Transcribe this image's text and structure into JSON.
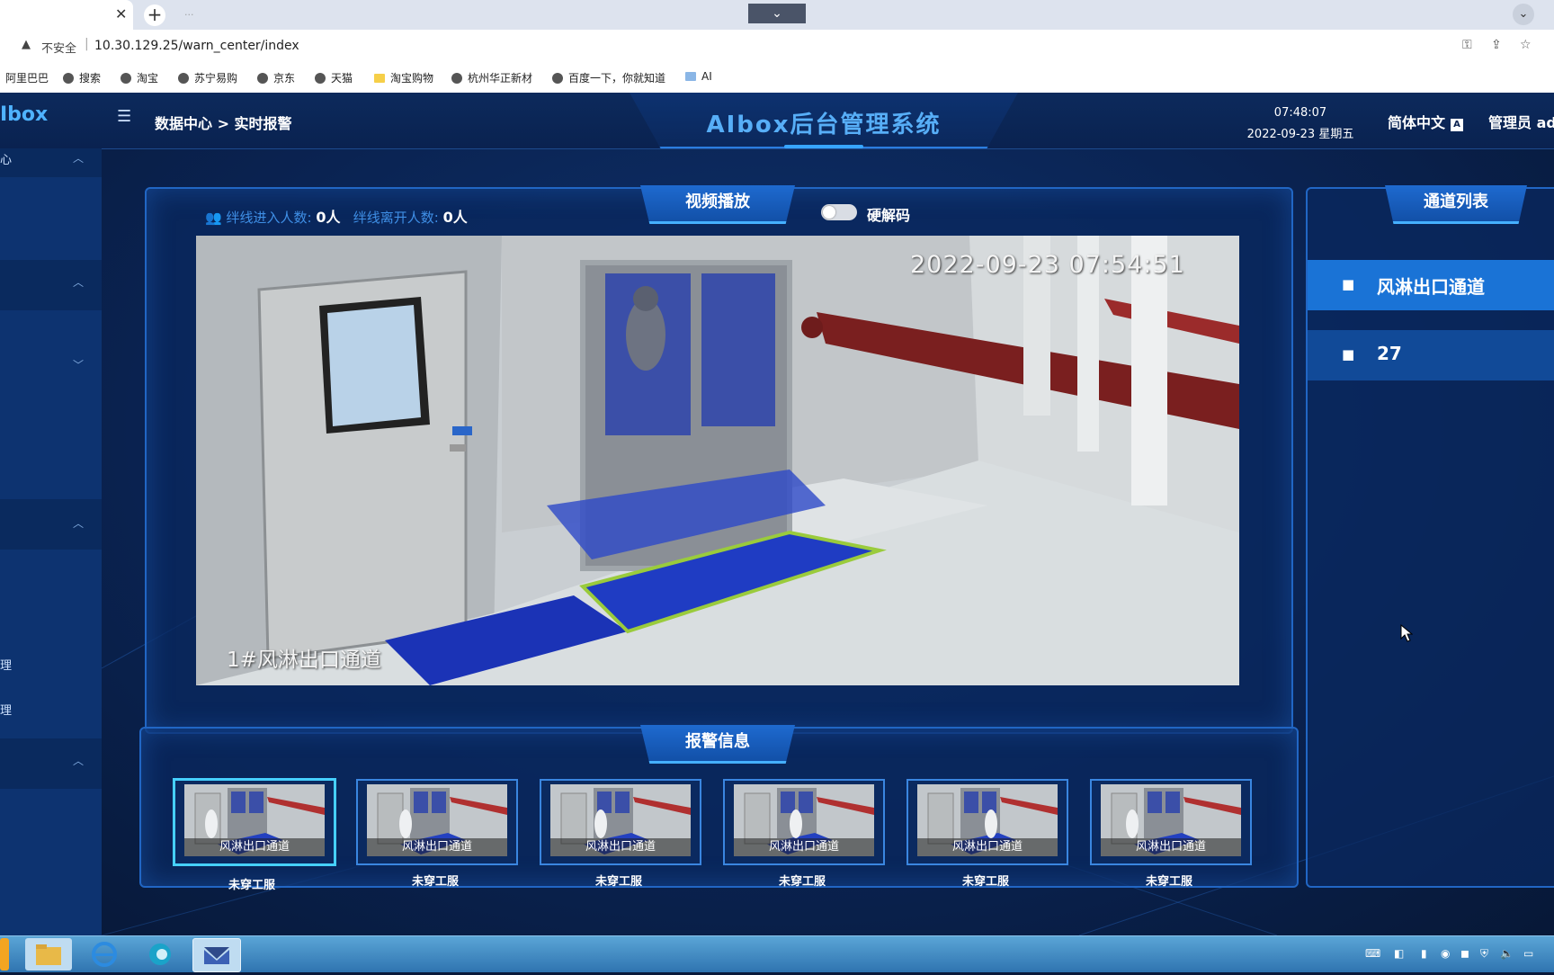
{
  "browser": {
    "tab_close": "✕",
    "new_tab": "+",
    "tab2_title": "···",
    "dropdown": "⌄",
    "tab_search": "⌄",
    "security_icon": "warning-icon",
    "insecure_label": "不安全",
    "url": "10.30.129.25/warn_center/index",
    "bookmarks": [
      "阿里巴巴",
      "搜索",
      "淘宝",
      "苏宁易购",
      "京东",
      "天猫",
      "淘宝购物",
      "杭州华正新材",
      "百度一下，你就知道",
      "AI"
    ]
  },
  "app": {
    "logo": "Ibox",
    "breadcrumb": "数据中心  >  实时报警",
    "title": "AIbox后台管理系统",
    "time": "07:48:07",
    "date": "2022-09-23 星期五",
    "language": "简体中文",
    "language_icon": "A",
    "user": "管理员 ad"
  },
  "sidebar": {
    "top_label": "心",
    "items": [
      "理",
      "理"
    ]
  },
  "video": {
    "tab_label": "视频播放",
    "enter_label": "绊线进入人数:",
    "enter_value": "0人",
    "leave_label": "绊线离开人数:",
    "leave_value": "0人",
    "hw_decode_label": "硬解码",
    "hw_decode_on": false,
    "timestamp": "2022-09-23 07:54:51",
    "caption": "1#风淋出口通道"
  },
  "alarms": {
    "tab_label": "报警信息",
    "items": [
      {
        "channel": "风淋出口通道",
        "type": "未穿工服"
      },
      {
        "channel": "风淋出口通道",
        "type": "未穿工服"
      },
      {
        "channel": "风淋出口通道",
        "type": "未穿工服"
      },
      {
        "channel": "风淋出口通道",
        "type": "未穿工服"
      },
      {
        "channel": "风淋出口通道",
        "type": "未穿工服"
      },
      {
        "channel": "风淋出口通道",
        "type": "未穿工服"
      }
    ]
  },
  "channels": {
    "tab_label": "通道列表",
    "items": [
      {
        "label": "风淋出口通道",
        "active": true
      },
      {
        "label": "27",
        "active": false
      }
    ]
  },
  "colors": {
    "accent": "#1e6ad0",
    "active_channel": "#1a73d6",
    "inactive_channel": "#114a98"
  }
}
